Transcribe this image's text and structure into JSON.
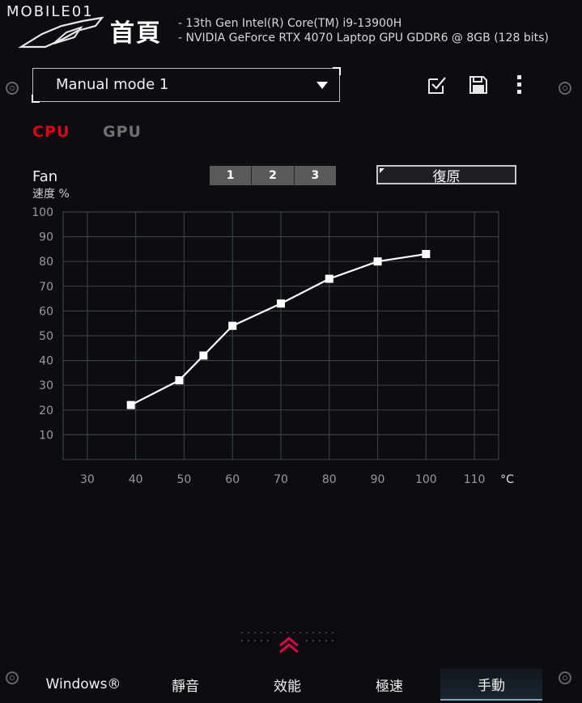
{
  "header": {
    "logo_text": "MOBILE01",
    "home_title": "首頁",
    "specs": [
      "-   13th Gen Intel(R) Core(TM) i9-13900H",
      "-   NVIDIA GeForce RTX 4070 Laptop GPU GDDR6 @ 8GB (128 bits)"
    ]
  },
  "mode_select": {
    "value": "Manual mode 1"
  },
  "toolbar": {
    "apply_icon": "checkbox-check-icon",
    "save_icon": "floppy-disk-icon",
    "menu_icon": "vertical-ellipsis-icon"
  },
  "processor_tabs": [
    {
      "label": "CPU",
      "active": true
    },
    {
      "label": "GPU",
      "active": false
    }
  ],
  "fan_panel": {
    "title": "Fan",
    "subtitle": "速度 %",
    "profiles": [
      "1",
      "2",
      "3"
    ],
    "restore_label": "復原"
  },
  "chart_data": {
    "type": "line",
    "title": "",
    "xlabel": "°C",
    "ylabel": "速度 %",
    "xlim": [
      25,
      115
    ],
    "ylim": [
      0,
      100
    ],
    "x_ticks": [
      30,
      40,
      50,
      60,
      70,
      80,
      90,
      100,
      110
    ],
    "y_ticks": [
      10,
      20,
      30,
      40,
      50,
      60,
      70,
      80,
      90,
      100
    ],
    "x_tick_labels": [
      "30",
      "40",
      "50",
      "60",
      "70",
      "80",
      "90",
      "100",
      "110"
    ],
    "y_tick_labels": [
      "10",
      "20",
      "30",
      "40",
      "50",
      "60",
      "70",
      "80",
      "90",
      "100"
    ],
    "grid": true,
    "series": [
      {
        "x": [
          39,
          49,
          54,
          60,
          70,
          80,
          90,
          100
        ],
        "y": [
          22,
          32,
          42,
          54,
          63,
          73,
          80,
          83
        ]
      }
    ],
    "colors": {
      "line": "#ffffff",
      "grid": "#3a3d42",
      "axis_text": "#9a9a9a",
      "unit_text": "#e0e0e0"
    }
  },
  "bottom_tabs": [
    {
      "label": "Windows®",
      "active": false
    },
    {
      "label": "靜音",
      "active": false
    },
    {
      "label": "效能",
      "active": false
    },
    {
      "label": "極速",
      "active": false
    },
    {
      "label": "手動",
      "active": true
    }
  ],
  "colors": {
    "accent": "#e0001a",
    "background": "#0b0d10",
    "active_tab": "#1b2630"
  }
}
